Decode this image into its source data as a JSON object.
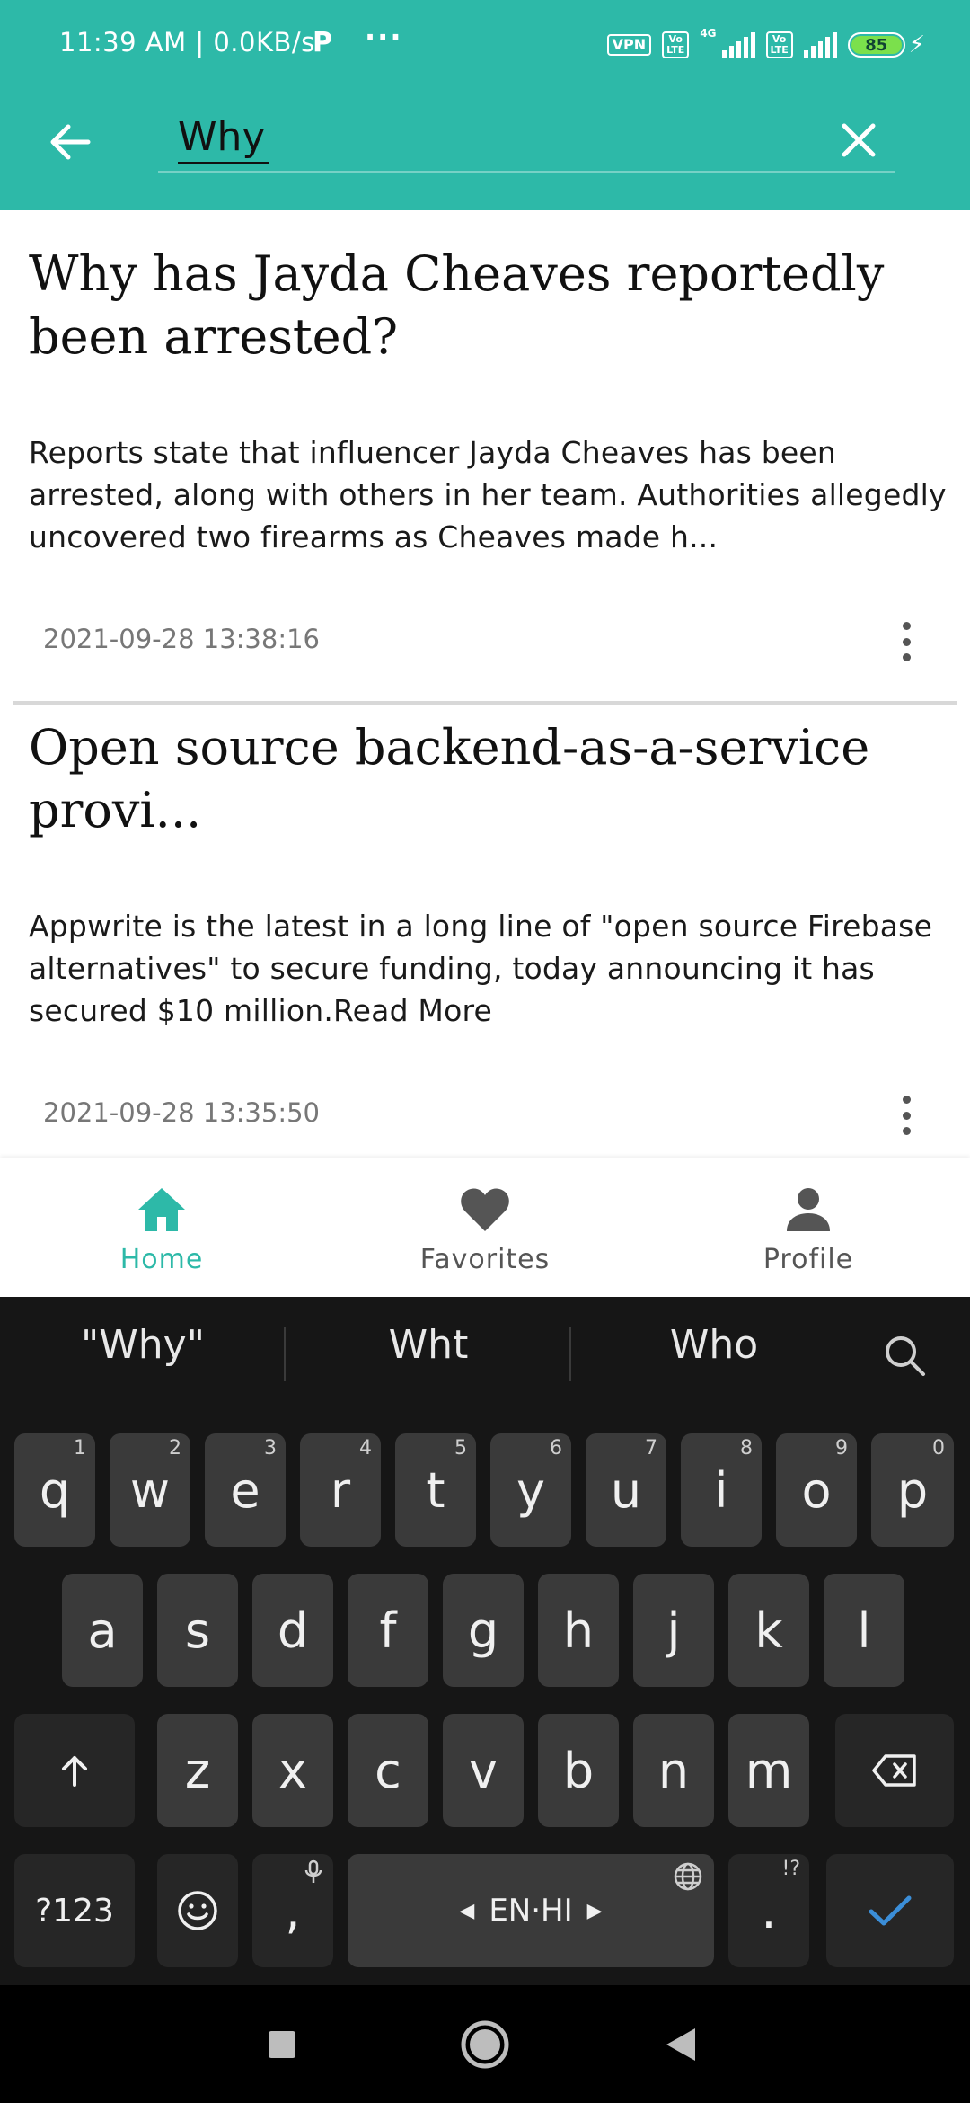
{
  "status_bar": {
    "time_speed": "11:39 AM | 0.0KB/s",
    "p_icon": "P",
    "dots": "···",
    "vpn": "VPN",
    "volte1": "Vo LTE",
    "network": "4G",
    "volte2": "Vo LTE",
    "battery": "85"
  },
  "search": {
    "query": "Why"
  },
  "articles": [
    {
      "title": "Why has Jayda Cheaves reportedly been arrested?",
      "description": "Reports state that influencer Jayda Cheaves has been arrested, along with others in her team. Authorities allegedly uncovered two firearms as Cheaves made h...",
      "date": "2021-09-28 13:38:16"
    },
    {
      "title": "Open source backend-as-a-service provi...",
      "description": "Appwrite is the latest in a long line of \"open source Firebase alternatives\" to secure funding, today announcing it has secured $10 million.Read More",
      "date": "2021-09-28 13:35:50"
    }
  ],
  "bottom_nav": {
    "home": "Home",
    "favorites": "Favorites",
    "profile": "Profile",
    "active_color": "#2db9a8",
    "inactive_color": "#555555"
  },
  "keyboard": {
    "suggestions": [
      "\"Why\"",
      "Wht",
      "Who"
    ],
    "row1": [
      {
        "k": "q",
        "h": "1"
      },
      {
        "k": "w",
        "h": "2"
      },
      {
        "k": "e",
        "h": "3"
      },
      {
        "k": "r",
        "h": "4"
      },
      {
        "k": "t",
        "h": "5"
      },
      {
        "k": "y",
        "h": "6"
      },
      {
        "k": "u",
        "h": "7"
      },
      {
        "k": "i",
        "h": "8"
      },
      {
        "k": "o",
        "h": "9"
      },
      {
        "k": "p",
        "h": "0"
      }
    ],
    "row2": [
      "a",
      "s",
      "d",
      "f",
      "g",
      "h",
      "j",
      "k",
      "l"
    ],
    "row3": [
      "z",
      "x",
      "c",
      "v",
      "b",
      "n",
      "m"
    ],
    "symbols": "?123",
    "comma": ",",
    "space": "EN·HI",
    "period": ".",
    "period_hint": "!?"
  },
  "colors": {
    "header": "#2db9a8",
    "keyboard_bg": "#161616",
    "key_bg": "#3a3a3a",
    "enter_check": "#3b8ed8"
  }
}
